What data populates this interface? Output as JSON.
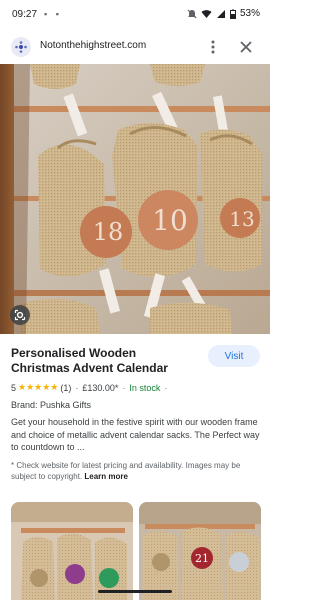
{
  "status_bar": {
    "time": "09:27",
    "left_icons": "▪ ▪",
    "battery": "53%"
  },
  "url_bar": {
    "site": "Notonthehighstreet.com"
  },
  "product": {
    "title": "Personalised Wooden Christmas Advent Calendar",
    "visit_label": "Visit",
    "rating": "5",
    "stars": "★★★★★",
    "review_count": "(1)",
    "price": "£130.00*",
    "availability": "In stock",
    "brand": "Brand: Pushka Gifts",
    "description": "Get your household in the festive spirit with our wooden frame and choice of metallic advent calendar sacks. The Perfect way to countdown to ...",
    "disclaimer": "* Check website for latest pricing and availability. Images may be subject to copyright.",
    "learn_more": "Learn more"
  },
  "hero_image": {
    "sack_numbers": [
      "18",
      "10",
      "13"
    ]
  },
  "thumbnails": {
    "sack_numbers": [
      "21"
    ]
  },
  "colors": {
    "accent": "#1a73e8",
    "visit_bg": "#e8f0fe",
    "in_stock": "#188038",
    "star": "#f4b400",
    "copper": "#c98a5e",
    "hessian": "#cdb48a"
  }
}
